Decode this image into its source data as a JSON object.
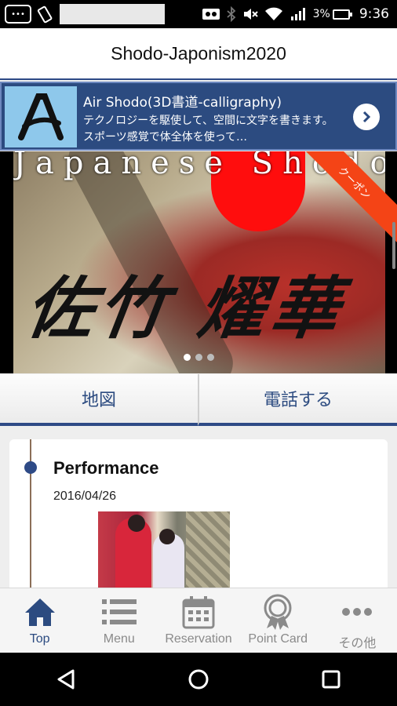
{
  "status_bar": {
    "battery": "3%",
    "time": "9:36",
    "icons": [
      "notification-chip-icon",
      "phone-rotate-icon",
      "cassette-icon",
      "bluetooth-icon",
      "mute-icon",
      "wifi-icon",
      "signal-icon",
      "battery-charging-icon"
    ]
  },
  "header": {
    "title": "Shodo-Japonism2020"
  },
  "ad": {
    "title": "Air Shodo(3D書道-calligraphy)",
    "description": "テクノロジーを駆使して、空間に文字を書きます。スポーツ感覚で体全体を使って…",
    "logo_icon": "calligraphy-a-logo-icon",
    "action_icon": "chevron-right-icon"
  },
  "hero": {
    "heading": "Japanese Shodo",
    "calligraphy": "佐竹 燿華",
    "ribbon": "クーポン",
    "slides": 3,
    "active_slide": 0
  },
  "actions": {
    "map_label": "地図",
    "call_label": "電話する"
  },
  "timeline": {
    "items": [
      {
        "title": "Performance",
        "date": "2016/04/26"
      }
    ]
  },
  "bottom_nav": {
    "items": [
      {
        "label": "Top",
        "icon": "home-icon",
        "active": true
      },
      {
        "label": "Menu",
        "icon": "list-icon",
        "active": false
      },
      {
        "label": "Reservation",
        "icon": "calendar-icon",
        "active": false
      },
      {
        "label": "Point Card",
        "icon": "award-badge-icon",
        "active": false
      },
      {
        "label": "その他",
        "icon": "more-dots-icon",
        "active": false
      }
    ]
  },
  "colors": {
    "brand": "#2c4b80",
    "ribbon": "#f44416",
    "sun": "#ff0d0d",
    "timeline_dot": "#2e4a86"
  }
}
